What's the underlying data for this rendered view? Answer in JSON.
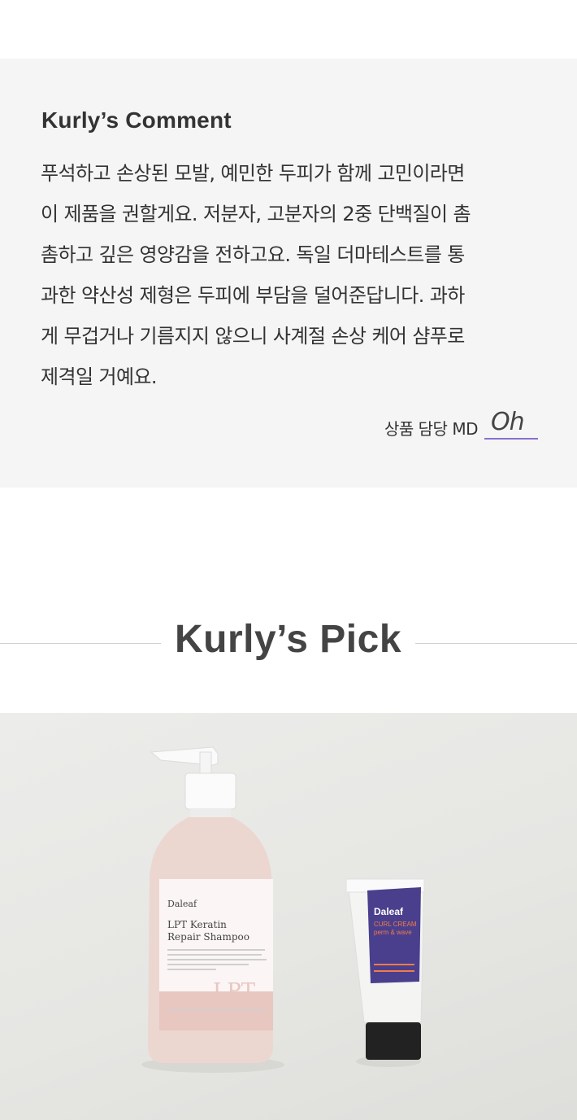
{
  "comment": {
    "title": "Kurly’s Comment",
    "lines": [
      "푸석하고 손상된 모발, 예민한 두피가 함께 고민이라면",
      "이 제품을 권할게요. 저분자, 고분자의 2중 단백질이 촘",
      "촘하고 깊은 영양감을 전하고요. 독일 더마테스트를 통",
      "과한 약산성 제형은 두피에 부담을 덜어준답니다. 과하",
      "게 무겁거나 기름지지 않으니 사계절 손상 케어 샴푸로",
      "제격일 거예요."
    ],
    "md_label": "상품 담당 MD",
    "md_name": "Oh"
  },
  "pick": {
    "title": "Kurly’s Pick"
  },
  "product_photo": {
    "shampoo": {
      "brand": "Daleaf",
      "name_line1": "LPT Keratin",
      "name_line2": "Repair Shampoo",
      "badge": "LPT"
    },
    "cream": {
      "brand": "Daleaf",
      "name_line1": "CURL CREAM",
      "name_line2": "perm & wave"
    },
    "colors": {
      "bottle": "#ecd7d0",
      "label_band": "#e8c7c1",
      "tube_label": "#4a3f8c",
      "tube_accent": "#f07c4b",
      "md_underline": "#8b6fcf"
    }
  }
}
